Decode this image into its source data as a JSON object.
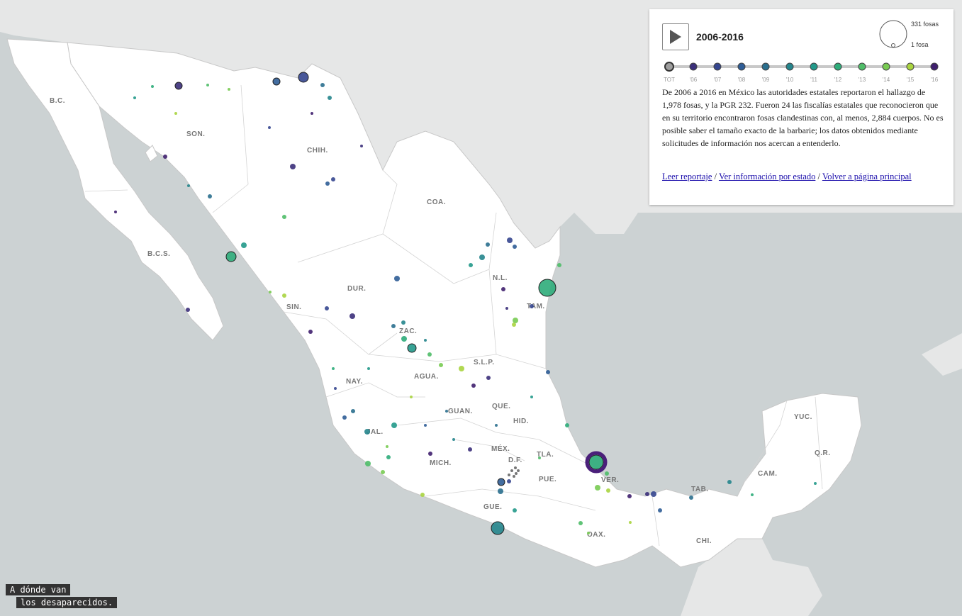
{
  "panel": {
    "play_label": "play",
    "year_range": "2006-2016",
    "legend_max": "331 fosas",
    "legend_min": "1 fosa",
    "description": "De 2006 a 2016 en México las autoridades estatales reportaron el hallazgo de 1,978 fosas, y la PGR 232. Fueron 24 las fiscalías estatales que reconocieron que en su territorio encontraron fosas clandestinas con, al menos, 2,884 cuerpos. No es posible saber el tamaño exacto de la barbarie; los datos obtenidos mediante solicitudes de información nos acercan a entenderlo.",
    "links": [
      "Leer reportaje",
      "Ver información por estado",
      "Volver a página principal"
    ],
    "link_separator": "/"
  },
  "timeline": {
    "years": [
      "TOT",
      "'06",
      "'07",
      "'08",
      "'09",
      "'10",
      "'11",
      "'12",
      "'13",
      "'14",
      "'15",
      "'16"
    ],
    "colors": [
      "#9e9e9e",
      "#3b2f7a",
      "#35468f",
      "#2f5d96",
      "#2a6f8e",
      "#25858c",
      "#22998a",
      "#2eac7a",
      "#4fbd68",
      "#78cb52",
      "#a9d43f",
      "#3f1f6e"
    ],
    "selected": "TOT"
  },
  "states": [
    "B.C.",
    "SON.",
    "CHIH.",
    "COA.",
    "B.C.S.",
    "N.L.",
    "DUR.",
    "TAM.",
    "SIN.",
    "ZAC.",
    "S.L.P.",
    "AGUA.",
    "NAY.",
    "GUAN.",
    "QUE.",
    "HID.",
    "JAL.",
    "MÉX.",
    "TLA.",
    "D.F.",
    "MICH.",
    "PUE.",
    "VER.",
    "GUE.",
    "OAX.",
    "CHI.",
    "TAB.",
    "CAM.",
    "YUC.",
    "Q.R."
  ],
  "brand": {
    "line1": "A dónde van",
    "line2": "los desaparecidos."
  }
}
